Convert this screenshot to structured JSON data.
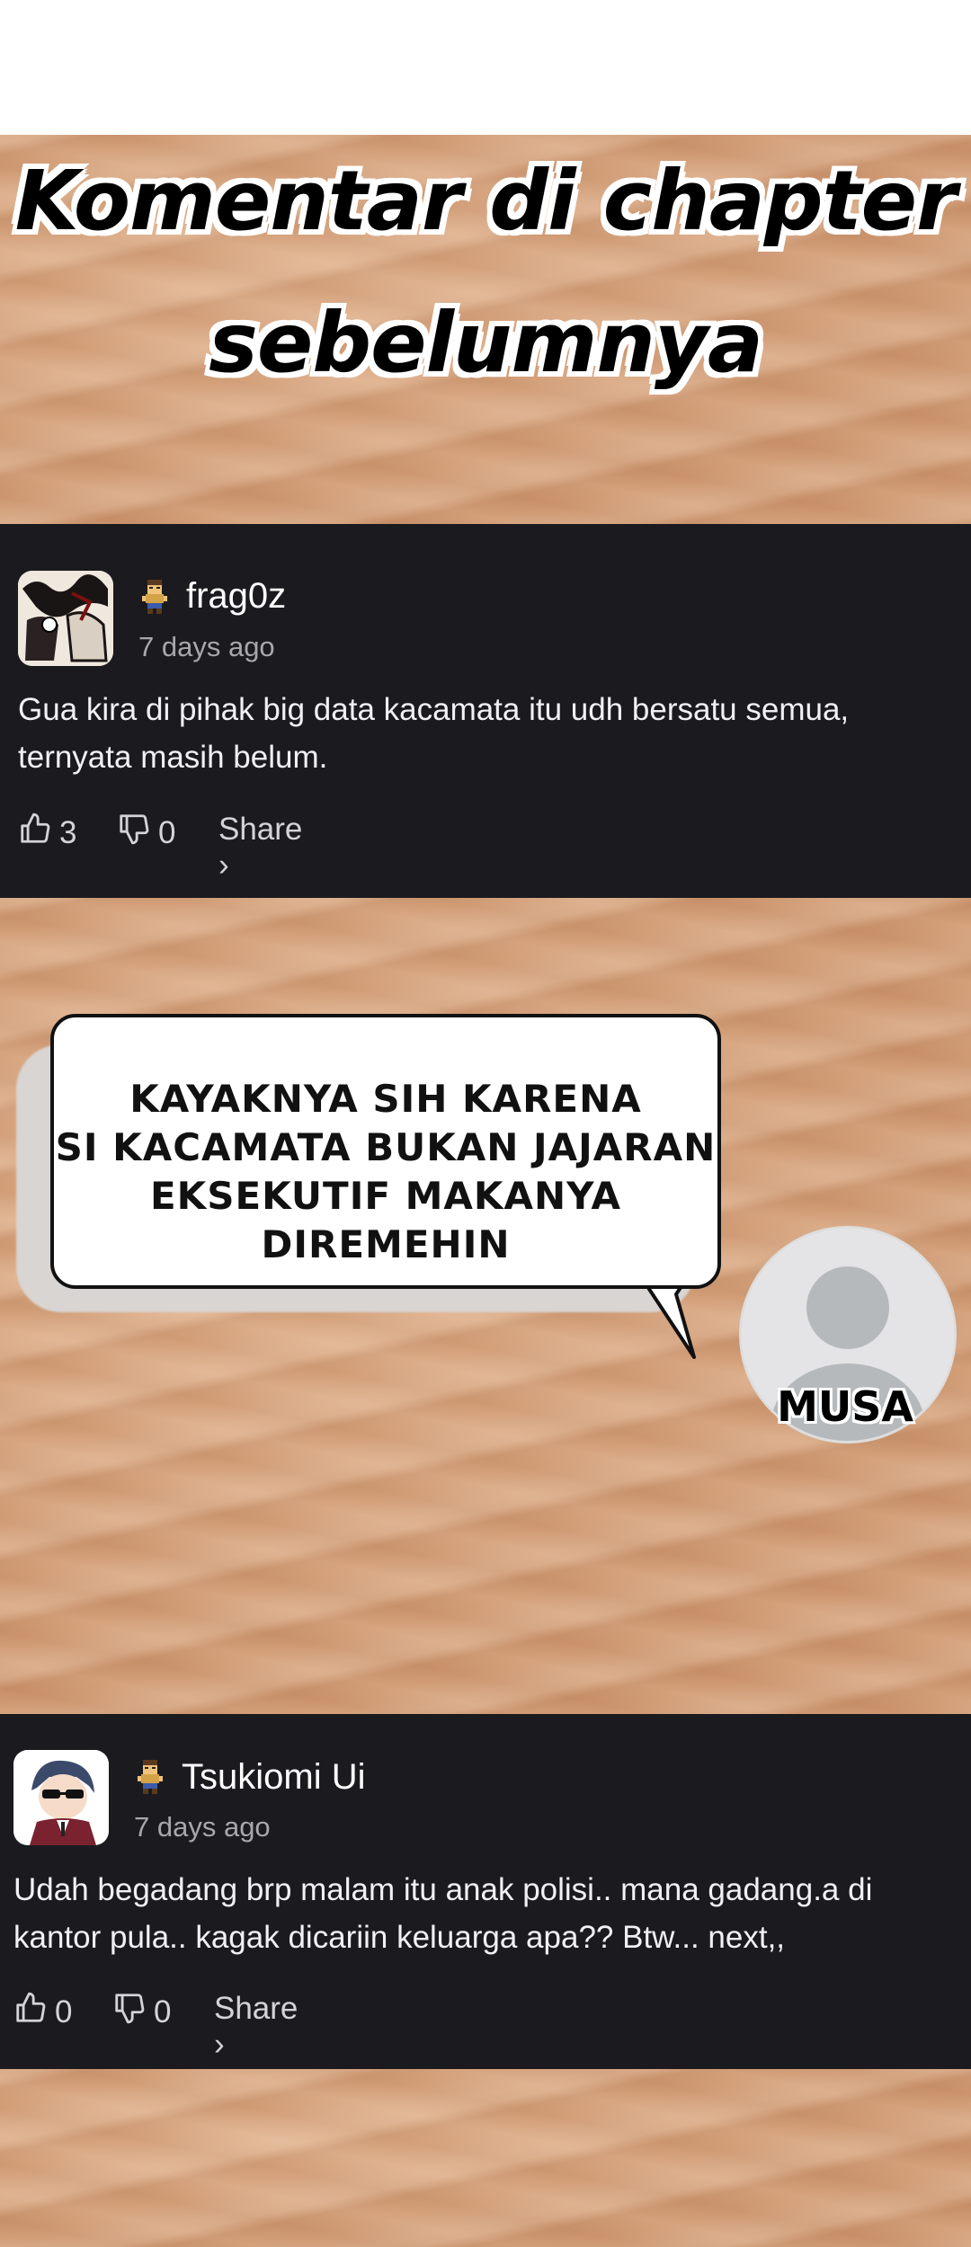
{
  "banner": {
    "line1": "Komentar di chapter",
    "line2": "sebelumnya"
  },
  "comments": [
    {
      "username": "frag0z",
      "time": "7 days ago",
      "body_line1": "Gua kira di pihak big data kacamata itu udh bersatu semua,",
      "body_line2": "ternyata masih belum.",
      "likes": "3",
      "dislikes": "0",
      "share": "Share ›"
    },
    {
      "username": "Tsukiomi Ui",
      "time": "7 days ago",
      "body_line1": "Udah begadang brp malam itu anak polisi.. mana gadang.a di",
      "body_line2": "kantor pula.. kagak dicariin keluarga apa?? Btw... next,,",
      "likes": "0",
      "dislikes": "0",
      "share": "Share ›"
    }
  ],
  "speech": {
    "line1": "KAYAKNYA SIH KARENA",
    "line2": "SI KACAMATA BUKAN JAJARAN",
    "line3": "EKSEKUTIF MAKANYA DIREMEHIN",
    "speaker": "MUSA"
  },
  "icons": {
    "like": "thumbs-up-icon",
    "dislike": "thumbs-down-icon",
    "badge": "pixel-character-icon"
  }
}
